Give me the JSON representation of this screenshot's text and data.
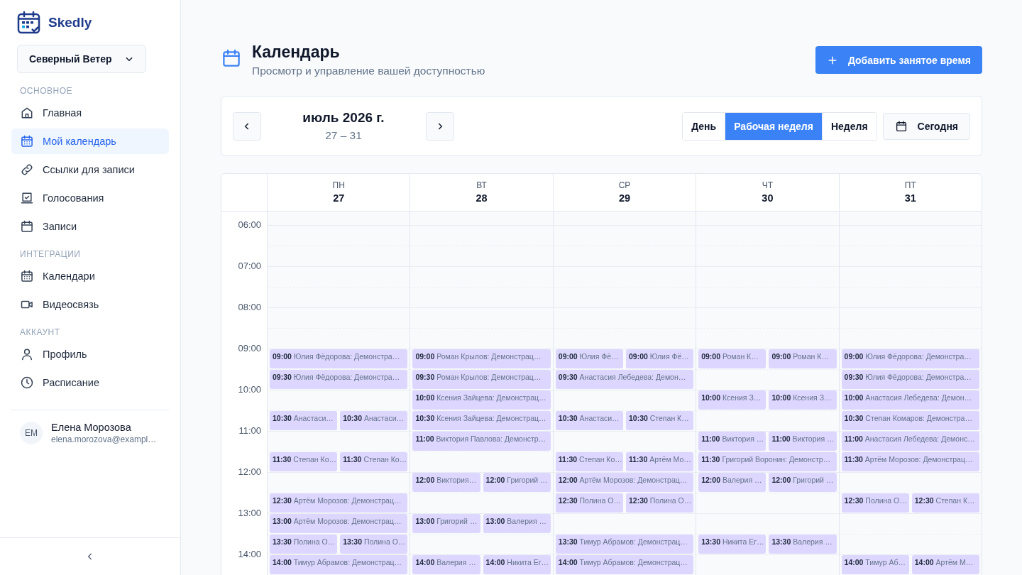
{
  "brand": {
    "name": "Skedly"
  },
  "workspace": {
    "label": "Северный Ветер"
  },
  "sidebar": {
    "sections": [
      {
        "heading": "ОСНОВНОЕ",
        "items": [
          {
            "label": "Главная",
            "selected": false
          },
          {
            "label": "Мой календарь",
            "selected": true
          },
          {
            "label": "Ссылки для записи",
            "selected": false
          },
          {
            "label": "Голосования",
            "selected": false
          },
          {
            "label": "Записи",
            "selected": false
          }
        ]
      },
      {
        "heading": "ИНТЕГРАЦИИ",
        "items": [
          {
            "label": "Календари",
            "selected": false
          },
          {
            "label": "Видеосвязь",
            "selected": false
          }
        ]
      },
      {
        "heading": "АККАУНТ",
        "items": [
          {
            "label": "Профиль",
            "selected": false
          },
          {
            "label": "Расписание",
            "selected": false
          }
        ]
      }
    ],
    "user": {
      "initials": "ЕМ",
      "name": "Елена Морозова",
      "email": "elena.morozova@exampl…"
    }
  },
  "page": {
    "title": "Календарь",
    "subtitle": "Просмотр и управление вашей доступностью",
    "add_button": "Добавить занятое время"
  },
  "toolbar": {
    "month": "июль 2026 г.",
    "range": "27 – 31",
    "views": [
      {
        "label": "День",
        "selected": false
      },
      {
        "label": "Рабочая неделя",
        "selected": true
      },
      {
        "label": "Неделя",
        "selected": false
      }
    ],
    "today_button": "Сегодня"
  },
  "calendar": {
    "hours": [
      "06:00",
      "07:00",
      "08:00",
      "09:00",
      "10:00",
      "11:00",
      "12:00",
      "13:00",
      "14:00"
    ],
    "days": [
      {
        "weekday": "ПН",
        "date": "27",
        "events": [
          {
            "time": "09:00",
            "title": "Юлия Фёдорова: Демонстра…",
            "kind": "full"
          },
          {
            "time": "09:30",
            "title": "Юлия Фёдорова: Демонстра…",
            "kind": "full"
          },
          {
            "time": "10:30",
            "title": "Анастаси…",
            "kind": "left"
          },
          {
            "time": "10:30",
            "title": "Анастаси…",
            "kind": "right"
          },
          {
            "time": "11:30",
            "title": "Степан Ко…",
            "kind": "left"
          },
          {
            "time": "11:30",
            "title": "Степан Ко…",
            "kind": "right"
          },
          {
            "time": "12:30",
            "title": "Артём Морозов: Демонстрац…",
            "kind": "full"
          },
          {
            "time": "13:00",
            "title": "Артём Морозов: Демонстрац…",
            "kind": "full"
          },
          {
            "time": "13:30",
            "title": "Полина О…",
            "kind": "left"
          },
          {
            "time": "13:30",
            "title": "Полина О…",
            "kind": "right"
          },
          {
            "time": "14:00",
            "title": "Тимур Абрамов: Демонстрац…",
            "kind": "full"
          }
        ]
      },
      {
        "weekday": "ВТ",
        "date": "28",
        "events": [
          {
            "time": "09:00",
            "title": "Роман Крылов: Демонстрац…",
            "kind": "full"
          },
          {
            "time": "09:30",
            "title": "Роман Крылов: Демонстрац…",
            "kind": "full"
          },
          {
            "time": "10:00",
            "title": "Ксения Зайцева: Демонстрац…",
            "kind": "full"
          },
          {
            "time": "10:30",
            "title": "Ксения Зайцева: Демонстрац…",
            "kind": "full"
          },
          {
            "time": "11:00",
            "title": "Виктория Павлова: Демонстр…",
            "kind": "full"
          },
          {
            "time": "12:00",
            "title": "Виктория…",
            "kind": "left"
          },
          {
            "time": "12:00",
            "title": "Григорий …",
            "kind": "right"
          },
          {
            "time": "13:00",
            "title": "Григорий …",
            "kind": "left"
          },
          {
            "time": "13:00",
            "title": "Валерия …",
            "kind": "right"
          },
          {
            "time": "14:00",
            "title": "Валерия …",
            "kind": "left"
          },
          {
            "time": "14:00",
            "title": "Никита Ег…",
            "kind": "right"
          }
        ]
      },
      {
        "weekday": "СР",
        "date": "29",
        "events": [
          {
            "time": "09:00",
            "title": "Юлия Фё…",
            "kind": "left"
          },
          {
            "time": "09:00",
            "title": "Юлия Фё…",
            "kind": "right"
          },
          {
            "time": "09:30",
            "title": "Анастасия Лебедева: Демон…",
            "kind": "full"
          },
          {
            "time": "10:30",
            "title": "Анастаси…",
            "kind": "left"
          },
          {
            "time": "10:30",
            "title": "Степан К…",
            "kind": "right"
          },
          {
            "time": "11:30",
            "title": "Степан Ко…",
            "kind": "left"
          },
          {
            "time": "11:30",
            "title": "Артём Мо…",
            "kind": "right"
          },
          {
            "time": "12:00",
            "title": "Артём Морозов: Демонстрац…",
            "kind": "full"
          },
          {
            "time": "12:30",
            "title": "Полина О…",
            "kind": "left"
          },
          {
            "time": "12:30",
            "title": "Полина О…",
            "kind": "right"
          },
          {
            "time": "13:30",
            "title": "Тимур Абрамов: Демонстрац…",
            "kind": "full"
          },
          {
            "time": "14:00",
            "title": "Тимур Абрамов: Демонстрац…",
            "kind": "full"
          }
        ]
      },
      {
        "weekday": "ЧТ",
        "date": "30",
        "events": [
          {
            "time": "09:00",
            "title": "Роман К…",
            "kind": "left"
          },
          {
            "time": "09:00",
            "title": "Роман К…",
            "kind": "right"
          },
          {
            "time": "10:00",
            "title": "Ксения З…",
            "kind": "left"
          },
          {
            "time": "10:00",
            "title": "Ксения З…",
            "kind": "right"
          },
          {
            "time": "11:00",
            "title": "Виктория …",
            "kind": "left"
          },
          {
            "time": "11:00",
            "title": "Виктория …",
            "kind": "right"
          },
          {
            "time": "11:30",
            "title": "Григорий Воронин: Демонстр…",
            "kind": "full"
          },
          {
            "time": "12:00",
            "title": "Валерия …",
            "kind": "left"
          },
          {
            "time": "12:00",
            "title": "Григорий …",
            "kind": "right"
          },
          {
            "time": "13:30",
            "title": "Никита Ег…",
            "kind": "left"
          },
          {
            "time": "13:30",
            "title": "Валерия …",
            "kind": "right"
          }
        ]
      },
      {
        "weekday": "ПТ",
        "date": "31",
        "events": [
          {
            "time": "09:00",
            "title": "Юлия Фёдорова: Демонстра…",
            "kind": "full"
          },
          {
            "time": "09:30",
            "title": "Юлия Фёдорова: Демонстра…",
            "kind": "full"
          },
          {
            "time": "10:00",
            "title": "Анастасия Лебедева: Демон…",
            "kind": "full"
          },
          {
            "time": "10:30",
            "title": "Степан Комаров: Демонстра…",
            "kind": "full"
          },
          {
            "time": "11:00",
            "title": "Анастасия Лебедева: Демонс…",
            "kind": "full"
          },
          {
            "time": "11:30",
            "title": "Артём Морозов: Демонстрац…",
            "kind": "full"
          },
          {
            "time": "12:30",
            "title": "Полина О…",
            "kind": "left"
          },
          {
            "time": "12:30",
            "title": "Степан К…",
            "kind": "right"
          },
          {
            "time": "14:00",
            "title": "Тимур Аб…",
            "kind": "left"
          },
          {
            "time": "14:00",
            "title": "Артём М…",
            "kind": "right"
          }
        ]
      }
    ]
  }
}
